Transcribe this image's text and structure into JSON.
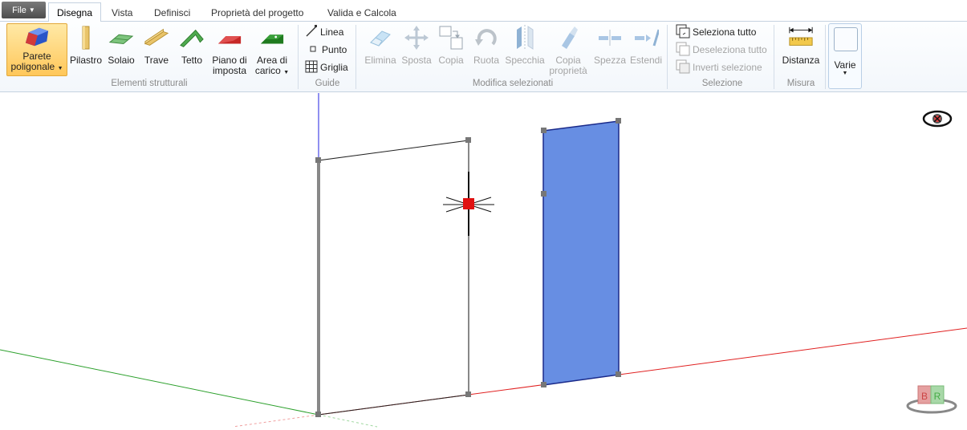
{
  "menu": {
    "file_label": "File",
    "tabs": [
      "Disegna",
      "Vista",
      "Definisci",
      "Proprietà del progetto",
      "Valida e Calcola"
    ]
  },
  "ribbon": {
    "elementi": {
      "group_label": "Elementi strutturali",
      "parete_line1": "Parete",
      "parete_line2": "poligonale",
      "pilastro": "Pilastro",
      "solaio": "Solaio",
      "trave": "Trave",
      "tetto": "Tetto",
      "piano_line1": "Piano di",
      "piano_line2": "imposta",
      "area_line1": "Area di",
      "area_line2": "carico"
    },
    "guide": {
      "group_label": "Guide",
      "linea": "Linea",
      "punto": "Punto",
      "griglia": "Griglia"
    },
    "modifica": {
      "group_label": "Modifica selezionati",
      "elimina": "Elimina",
      "sposta": "Sposta",
      "copia": "Copia",
      "ruota": "Ruota",
      "specchia": "Specchia",
      "copia_prop_line1": "Copia",
      "copia_prop_line2": "proprietà",
      "spezza": "Spezza",
      "estendi": "Estendi"
    },
    "selezione": {
      "group_label": "Selezione",
      "seleziona_tutto": "Seleziona tutto",
      "deseleziona_tutto": "Deseleziona tutto",
      "inverti_selezione": "Inverti selezione"
    },
    "misura": {
      "group_label": "Misura",
      "distanza": "Distanza"
    },
    "varie": {
      "label": "Varie"
    }
  },
  "viewport": {
    "logo_letters": [
      "B",
      "R"
    ],
    "colors": {
      "axis_x": "#e02020",
      "axis_y": "#20a020",
      "axis_z": "#2020e0",
      "selected_wall_fill": "#678ee3",
      "cursor_marker": "#e01010"
    }
  }
}
